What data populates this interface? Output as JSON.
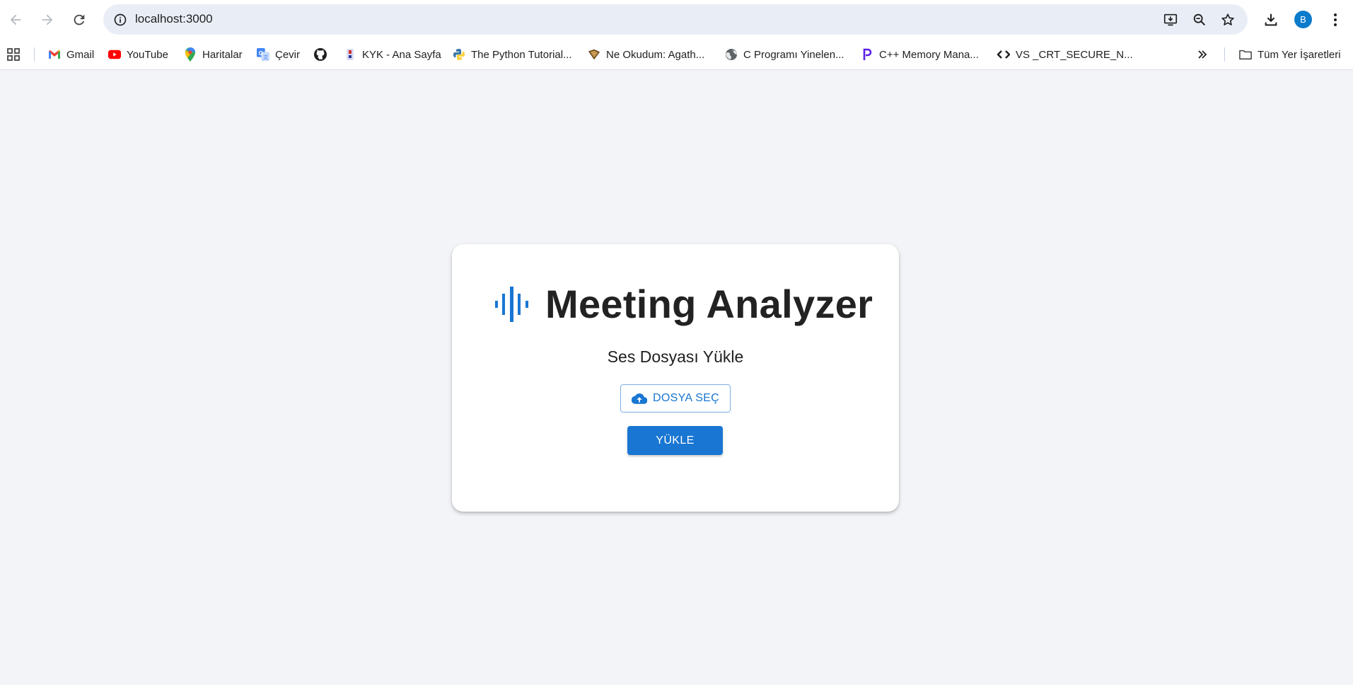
{
  "browser": {
    "url": "localhost:3000",
    "avatar_letter": "B",
    "bookmarks": [
      {
        "label": "Gmail",
        "icon": "gmail-icon"
      },
      {
        "label": "YouTube",
        "icon": "youtube-icon"
      },
      {
        "label": "Haritalar",
        "icon": "maps-icon"
      },
      {
        "label": "Çevir",
        "icon": "translate-icon"
      },
      {
        "label": "",
        "icon": "github-icon"
      },
      {
        "label": "KYK - Ana Sayfa",
        "icon": "kyk-icon"
      },
      {
        "label": "The Python Tutorial...",
        "icon": "python-icon"
      },
      {
        "label": "Ne Okudum: Agath...",
        "icon": "book-icon"
      },
      {
        "label": "C Programı Yinelen...",
        "icon": "globe-icon"
      },
      {
        "label": "C++ Memory Mana...",
        "icon": "p-logo-icon"
      },
      {
        "label": "VS _CRT_SECURE_N...",
        "icon": "code-icon"
      }
    ],
    "all_bookmarks_label": "Tüm Yer İşaretleri"
  },
  "app": {
    "title": "Meeting Analyzer",
    "subtitle": "Ses Dosyası Yükle",
    "choose_file_label": "DOSYA SEÇ",
    "upload_label": "YÜKLE"
  },
  "colors": {
    "accent": "#1976d2",
    "page_background": "#f3f4f8",
    "card_background": "#ffffff",
    "title_text": "#222222"
  }
}
